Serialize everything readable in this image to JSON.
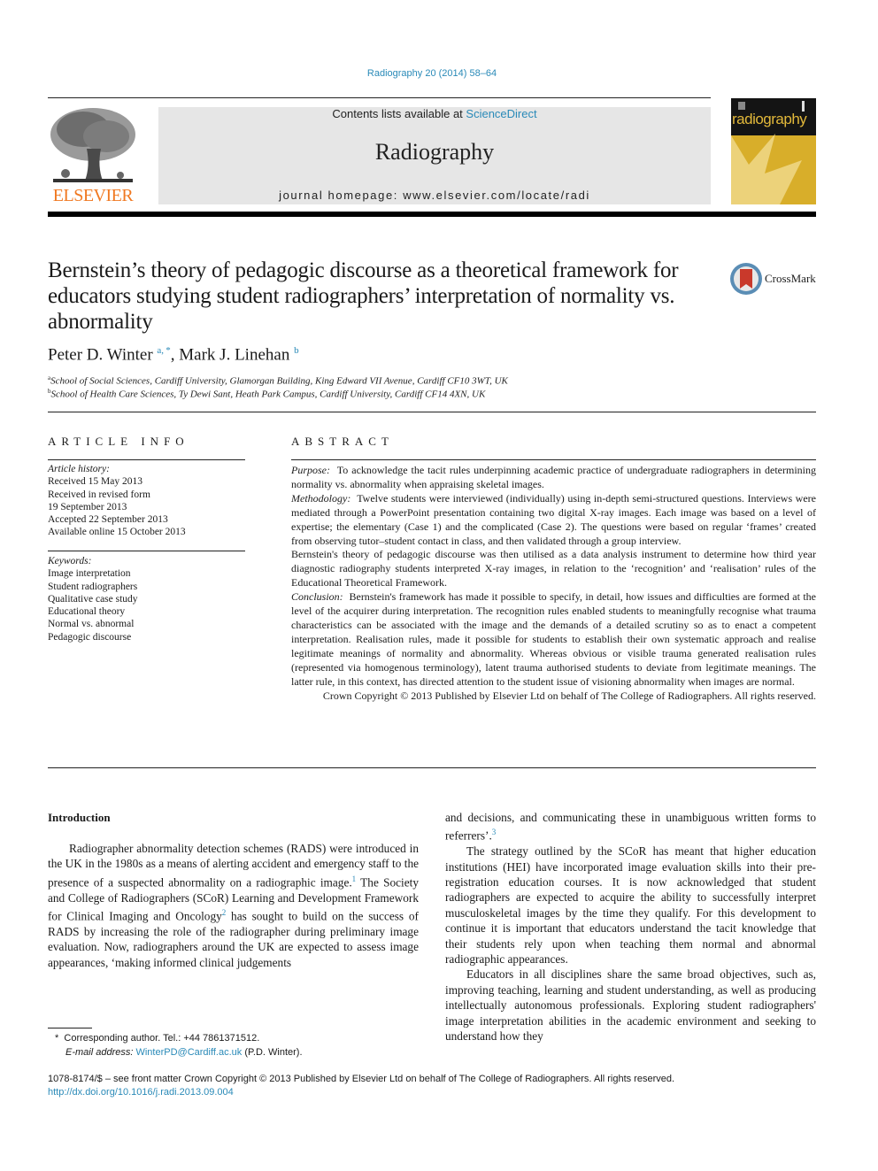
{
  "citation": "Radiography 20 (2014) 58–64",
  "masthead": {
    "contents_prefix": "Contents lists available at ",
    "contents_link": "ScienceDirect",
    "journal_title": "Radiography",
    "homepage": "journal homepage: www.elsevier.com/locate/radi"
  },
  "publisher_logo": {
    "icon": "elsevier-tree-icon",
    "wordmark": "ELSEVIER",
    "color": "#f07820"
  },
  "cover": {
    "icon": "journal-cover-icon",
    "title": "radiography",
    "colors": {
      "dark": "#141414",
      "gold": "#d8ae2a"
    }
  },
  "crossmark": {
    "icon": "crossmark-icon",
    "label": "CrossMark"
  },
  "article": {
    "title": "Bernstein’s theory of pedagogic discourse as a theoretical framework for educators studying student radiographers’ interpretation of normality vs. abnormality",
    "authors": [
      {
        "name": "Peter D. Winter",
        "marks": "a, *"
      },
      {
        "name": "Mark J. Linehan",
        "marks": "b"
      }
    ],
    "author_separator": ", ",
    "affiliations": [
      {
        "mark": "a",
        "text": "School of Social Sciences, Cardiff University, Glamorgan Building, King Edward VII Avenue, Cardiff CF10 3WT, UK"
      },
      {
        "mark": "b",
        "text": "School of Health Care Sciences, Ty Dewi Sant, Heath Park Campus, Cardiff University, Cardiff CF14 4XN, UK"
      }
    ]
  },
  "article_info": {
    "heading": "ARTICLE INFO",
    "history_label": "Article history:",
    "history": [
      "Received 15 May 2013",
      "Received in revised form",
      "19 September 2013",
      "Accepted 22 September 2013",
      "Available online 15 October 2013"
    ],
    "keywords_label": "Keywords:",
    "keywords": [
      "Image interpretation",
      "Student radiographers",
      "Qualitative case study",
      "Educational theory",
      "Normal vs. abnormal",
      "Pedagogic discourse"
    ]
  },
  "abstract": {
    "heading": "ABSTRACT",
    "purpose_label": "Purpose:",
    "purpose": "To acknowledge the tacit rules underpinning academic practice of undergraduate radiographers in determining normality vs. abnormality when appraising skeletal images.",
    "methodology_label": "Methodology:",
    "methodology": "Twelve students were interviewed (individually) using in-depth semi-structured questions. Interviews were mediated through a PowerPoint presentation containing two digital X-ray images. Each image was based on a level of expertise; the elementary (Case 1) and the complicated (Case 2). The questions were based on regular ‘frames’ created from observing tutor–student contact in class, and then validated through a group interview.",
    "analysis": "Bernstein's theory of pedagogic discourse was then utilised as a data analysis instrument to determine how third year diagnostic radiography students interpreted X-ray images, in relation to the ‘recognition’ and ‘realisation’ rules of the Educational Theoretical Framework.",
    "conclusion_label": "Conclusion:",
    "conclusion": "Bernstein's framework has made it possible to specify, in detail, how issues and difficulties are formed at the level of the acquirer during interpretation. The recognition rules enabled students to meaningfully recognise what trauma characteristics can be associated with the image and the demands of a detailed scrutiny so as to enact a competent interpretation. Realisation rules, made it possible for students to establish their own systematic approach and realise legitimate meanings of normality and abnormality. Whereas obvious or visible trauma generated realisation rules (represented via homogenous terminology), latent trauma authorised students to deviate from legitimate meanings. The latter rule, in this context, has directed attention to the student issue of visioning abnormality when images are normal.",
    "copyright": "Crown Copyright © 2013 Published by Elsevier Ltd on behalf of The College of Radiographers. All rights reserved."
  },
  "introduction": {
    "heading": "Introduction",
    "left_p1_a": "Radiographer abnormality detection schemes (RADS) were introduced in the UK in the 1980s as a means of alerting accident and emergency staff to the presence of a suspected abnormality on a radiographic image.",
    "left_p1_ref1": "1",
    "left_p1_b": " The Society and College of Radiographers (SCoR) Learning and Development Framework for Clinical Imaging and Oncology",
    "left_p1_ref2": "2",
    "left_p1_c": " has sought to build on the success of RADS by increasing the role of the radiographer during preliminary image evaluation. Now, radiographers around the UK are expected to assess image appearances, ‘making informed clinical judgements",
    "right_cont": "and decisions, and communicating these in unambiguous written forms to referrers’.",
    "right_cont_ref": "3",
    "right_p2": "The strategy outlined by the SCoR has meant that higher education institutions (HEI) have incorporated image evaluation skills into their pre-registration education courses. It is now acknowledged that student radiographers are expected to acquire the ability to successfully interpret musculoskeletal images by the time they qualify. For this development to continue it is important that educators understand the tacit knowledge that their students rely upon when teaching them normal and abnormal radiographic appearances.",
    "right_p3": "Educators in all disciplines share the same broad objectives, such as, improving teaching, learning and student understanding, as well as producing intellectually autonomous professionals. Exploring student radiographers' image interpretation abilities in the academic environment and seeking to understand how they"
  },
  "footnote": {
    "mark": "*",
    "corresponding": "Corresponding author. Tel.: +44 7861371512.",
    "email_label": "E-mail address:",
    "email": "WinterPD@Cardiff.ac.uk",
    "email_suffix": "(P.D. Winter)."
  },
  "footer": {
    "issn_line": "1078-8174/$ – see front matter Crown Copyright © 2013 Published by Elsevier Ltd on behalf of The College of Radiographers. All rights reserved.",
    "doi": "http://dx.doi.org/10.1016/j.radi.2013.09.004"
  }
}
